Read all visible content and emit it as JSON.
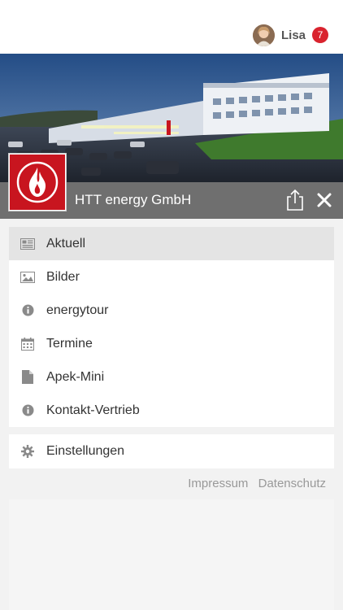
{
  "user": {
    "name": "Lisa",
    "badge_count": "7"
  },
  "company": {
    "name": "HTT energy GmbH"
  },
  "icons": {
    "share": "share-icon",
    "close": "close-icon",
    "logo": "flame-logo"
  },
  "menu": {
    "items": [
      {
        "label": "Aktuell",
        "icon": "newspaper-icon",
        "active": true
      },
      {
        "label": "Bilder",
        "icon": "image-icon",
        "active": false
      },
      {
        "label": "energytour",
        "icon": "info-icon",
        "active": false
      },
      {
        "label": "Termine",
        "icon": "calendar-icon",
        "active": false
      },
      {
        "label": "Apek-Mini",
        "icon": "document-icon",
        "active": false
      },
      {
        "label": "Kontakt-Vertrieb",
        "icon": "info-icon",
        "active": false
      }
    ]
  },
  "settings": {
    "label": "Einstellungen",
    "icon": "gear-icon"
  },
  "footer": {
    "impressum": "Impressum",
    "datenschutz": "Datenschutz"
  },
  "colors": {
    "brand_red": "#c8151f",
    "badge_red": "#d9232e",
    "bar_gray": "#6f6f6f"
  }
}
